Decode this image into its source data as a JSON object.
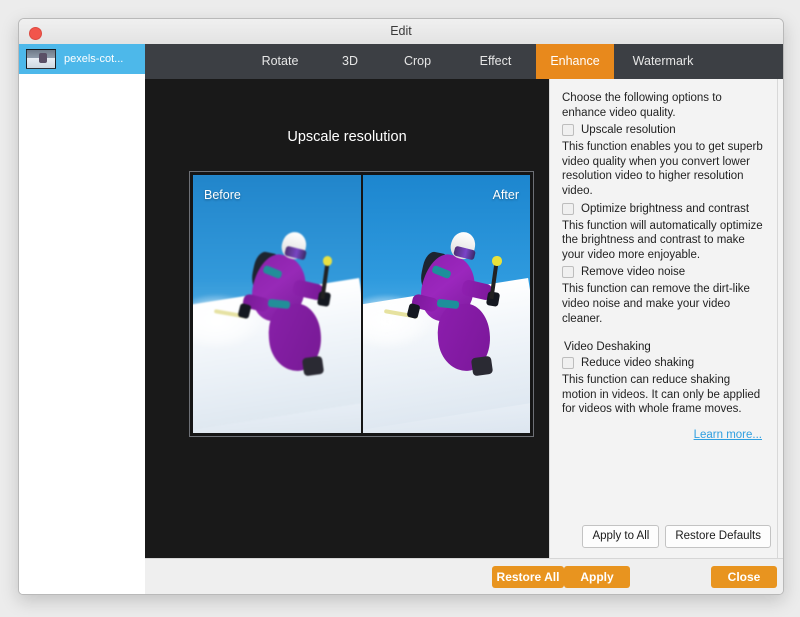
{
  "window": {
    "title": "Edit",
    "close_button": "close-red"
  },
  "sidebar": {
    "items": [
      {
        "label": "pexels-cot...",
        "icon": "video-thumbnail",
        "selected": true
      }
    ]
  },
  "tabs": [
    {
      "label": "Rotate",
      "active": false
    },
    {
      "label": "3D",
      "active": false
    },
    {
      "label": "Crop",
      "active": false
    },
    {
      "label": "Effect",
      "active": false
    },
    {
      "label": "Enhance",
      "active": true
    },
    {
      "label": "Watermark",
      "active": false
    }
  ],
  "preview": {
    "title": "Upscale resolution",
    "before_label": "Before",
    "after_label": "After"
  },
  "settings": {
    "intro": "Choose the following options to enhance video quality.",
    "options": [
      {
        "label": "Upscale resolution",
        "checked": false,
        "description": "This function enables you to get superb video quality when you convert lower resolution video to higher resolution video."
      },
      {
        "label": "Optimize brightness and contrast",
        "checked": false,
        "description": "This function will automatically optimize the brightness and contrast to make your video more enjoyable."
      },
      {
        "label": "Remove video noise",
        "checked": false,
        "description": "This function can remove the dirt-like video noise and make your video cleaner."
      }
    ],
    "deshaking": {
      "group_title": "Video Deshaking",
      "label": "Reduce video shaking",
      "checked": false,
      "description": "This function can reduce shaking motion in videos. It can only be applied for videos with whole frame moves."
    },
    "learn_more": "Learn more...",
    "panel_buttons": {
      "apply_to_all": "Apply to All",
      "restore_defaults": "Restore Defaults"
    }
  },
  "bottom_bar": {
    "restore_all": "Restore All",
    "apply": "Apply",
    "close": "Close"
  },
  "colors": {
    "accent_orange": "#e8941f",
    "tab_bar": "#3c3f44",
    "selection_blue": "#4db8ea",
    "link_blue": "#2f9fe0",
    "preview_background": "#191919"
  }
}
